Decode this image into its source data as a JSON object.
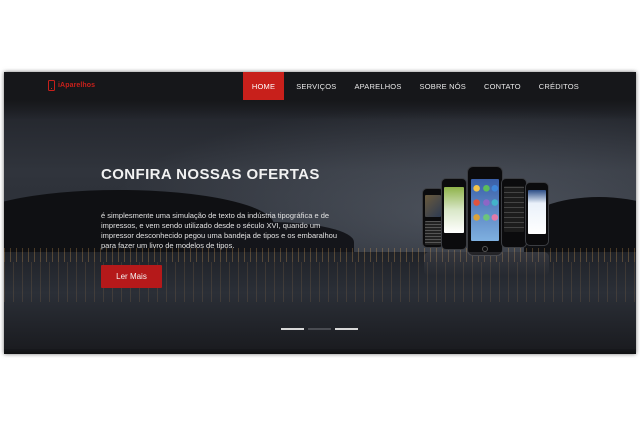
{
  "logo": {
    "icon": "phone-icon",
    "text": "iAparelhos"
  },
  "nav": {
    "items": [
      {
        "label": "HOME",
        "active": true
      },
      {
        "label": "SERVIÇOS",
        "active": false
      },
      {
        "label": "APARELHOS",
        "active": false
      },
      {
        "label": "SOBRE NÓS",
        "active": false
      },
      {
        "label": "CONTATO",
        "active": false
      },
      {
        "label": "CRÉDITOS",
        "active": false
      }
    ]
  },
  "hero": {
    "headline": "CONFIRA NOSSAS OFERTAS",
    "body": "é simplesmente uma simulação de texto da indústria tipográfica e de impressos, e vem sendo utilizado desde o século XVI, quando um impressor desconhecido pegou uma bandeja de tipos e os embaralhou para fazer um livro de modelos de tipos.",
    "cta_label": "Ler Mais"
  },
  "slider": {
    "slide_count": 3,
    "active_slide": 1
  },
  "colors": {
    "accent": "#c8201b",
    "navbar": "#16171a",
    "button": "#b5191a",
    "background": "#ffffff"
  }
}
